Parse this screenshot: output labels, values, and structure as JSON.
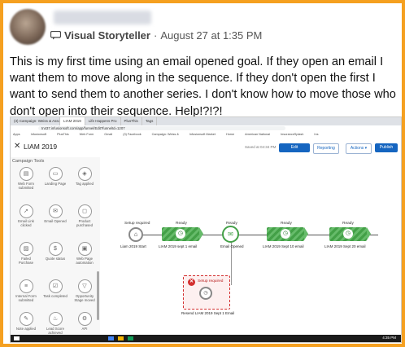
{
  "post": {
    "author_name": "",
    "role": "Visual Storyteller",
    "separator": "·",
    "timestamp": "August 27 at 1:35 PM",
    "body": "This is my first time using an email opened goal. If they open an email I want them to move along in the sequence. If they don't open the first I want to send them to another series. I don't know how to move those who don't open into their sequence. Help!?!?!"
  },
  "browser": {
    "tabs": [
      "(3) Campaign: Weiss & Associ",
      "LIAM 2019",
      "Life Happens Pro",
      "PlusThis",
      "Tags"
    ],
    "url": "tn437.infusionsoft.com/app/funnel/Edit?funnelId=1207",
    "bookmarks": [
      "Apps",
      "Infusionsoft",
      "PlusThis",
      "Web Form",
      "Gmail",
      "(3) Facebook",
      "Campaign: Weiss &",
      "Infusionsoft Market",
      "Home",
      "American National",
      "InsuranceSplash",
      "Ins"
    ]
  },
  "app": {
    "close": "✕",
    "title": "LIAM 2019",
    "saved_text": "Saved at 04:34 PM",
    "edit_label": "Edit",
    "reporting_label": "Reporting",
    "actions_label": "Actions ▾",
    "publish_label": "Publish"
  },
  "panel": {
    "title": "Campaign Tools",
    "tools": [
      {
        "label": "Web Form submitted"
      },
      {
        "label": "Landing Page"
      },
      {
        "label": "Tag applied"
      },
      {
        "label": "Email Link clicked"
      },
      {
        "label": "Email Opened"
      },
      {
        "label": "Product purchased"
      },
      {
        "label": "Failed Purchase"
      },
      {
        "label": "Quote status"
      },
      {
        "label": "Web Page automation"
      },
      {
        "label": "Internal Form submitted"
      },
      {
        "label": "Task completed"
      },
      {
        "label": "Opportunity Stage moved"
      },
      {
        "label": "Note applied"
      },
      {
        "label": "Lead Score achieved"
      },
      {
        "label": "API"
      }
    ]
  },
  "canvas": {
    "setup_required": "Setup required",
    "ready": "Ready",
    "start_label": "Liam 2019 Start",
    "seq1_label": "LIAM 2019 sept 1 email",
    "goal_label": "Email Opened",
    "seq2_label": "LIAM 2019 Sept 10 email",
    "seq3_label": "LIAM 2019 Sept 20 email",
    "resend_label": "Resend LIAM 2019 Sept 1 Email"
  },
  "taskbar": {
    "clock": "4:35 PM"
  },
  "colors": {
    "frame": "#f5a020",
    "ready_green": "#43a047",
    "primary_blue": "#1565c0",
    "error_red": "#d32f2f"
  }
}
